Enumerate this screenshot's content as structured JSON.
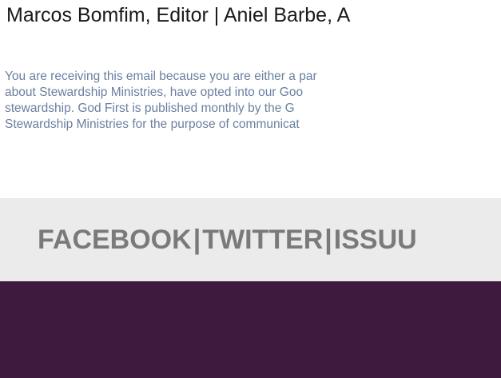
{
  "credits": {
    "editors_text": "Marcos Bomfim, Editor | Aniel Barbe, A"
  },
  "notice": {
    "lines": [
      "You are receiving this email because you are either a par",
      "about Stewardship Ministries, have opted into our Goo",
      "stewardship. God First is published monthly by the G",
      "Stewardship Ministries for the purpose of communicat"
    ]
  },
  "social": {
    "facebook_label": "FACEBOOK",
    "twitter_label": "TWITTER",
    "issuu_label": "ISSUU",
    "separator": "|"
  },
  "colors": {
    "social_bar_bg": "#ebebeb",
    "footer_band_bg": "#3e1a3f",
    "notice_text": "#6b7fa0",
    "social_text": "#7a7a7a"
  }
}
